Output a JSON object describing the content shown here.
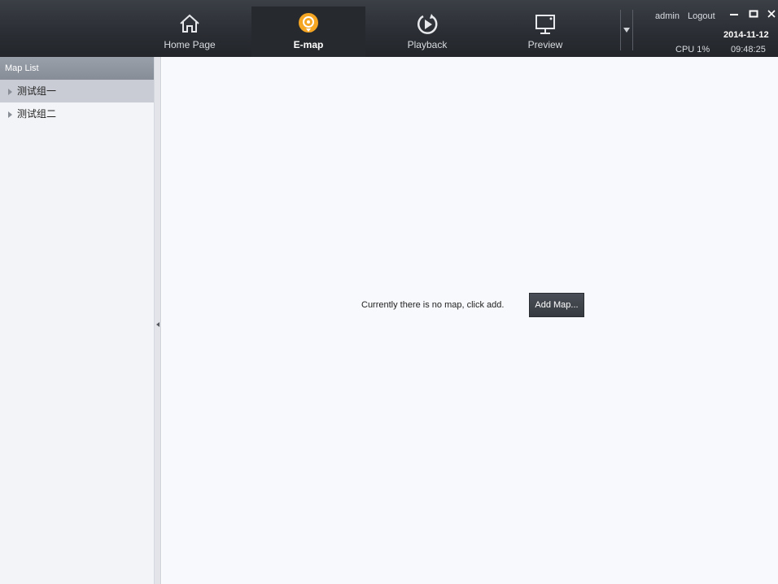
{
  "nav": {
    "tabs": [
      {
        "label": "Home Page",
        "icon": "home-icon"
      },
      {
        "label": "E-map",
        "icon": "map-pin-icon",
        "active": true
      },
      {
        "label": "Playback",
        "icon": "playback-icon"
      },
      {
        "label": "Preview",
        "icon": "monitor-icon"
      }
    ]
  },
  "header": {
    "user": "admin",
    "logout": "Logout",
    "date": "2014-11-12",
    "cpu": "CPU 1%",
    "time": "09:48:25"
  },
  "sidebar": {
    "title": "Map List",
    "items": [
      {
        "label": "测试组一",
        "selected": true
      },
      {
        "label": "测试组二",
        "selected": false
      }
    ]
  },
  "main": {
    "empty_message": "Currently there is no map, click add.",
    "add_button": "Add Map..."
  },
  "colors": {
    "accent": "#f5a623",
    "topbar": "#2a2d33",
    "sidebar_header": "#8f95a0",
    "selected_row": "#c9ccd4"
  }
}
